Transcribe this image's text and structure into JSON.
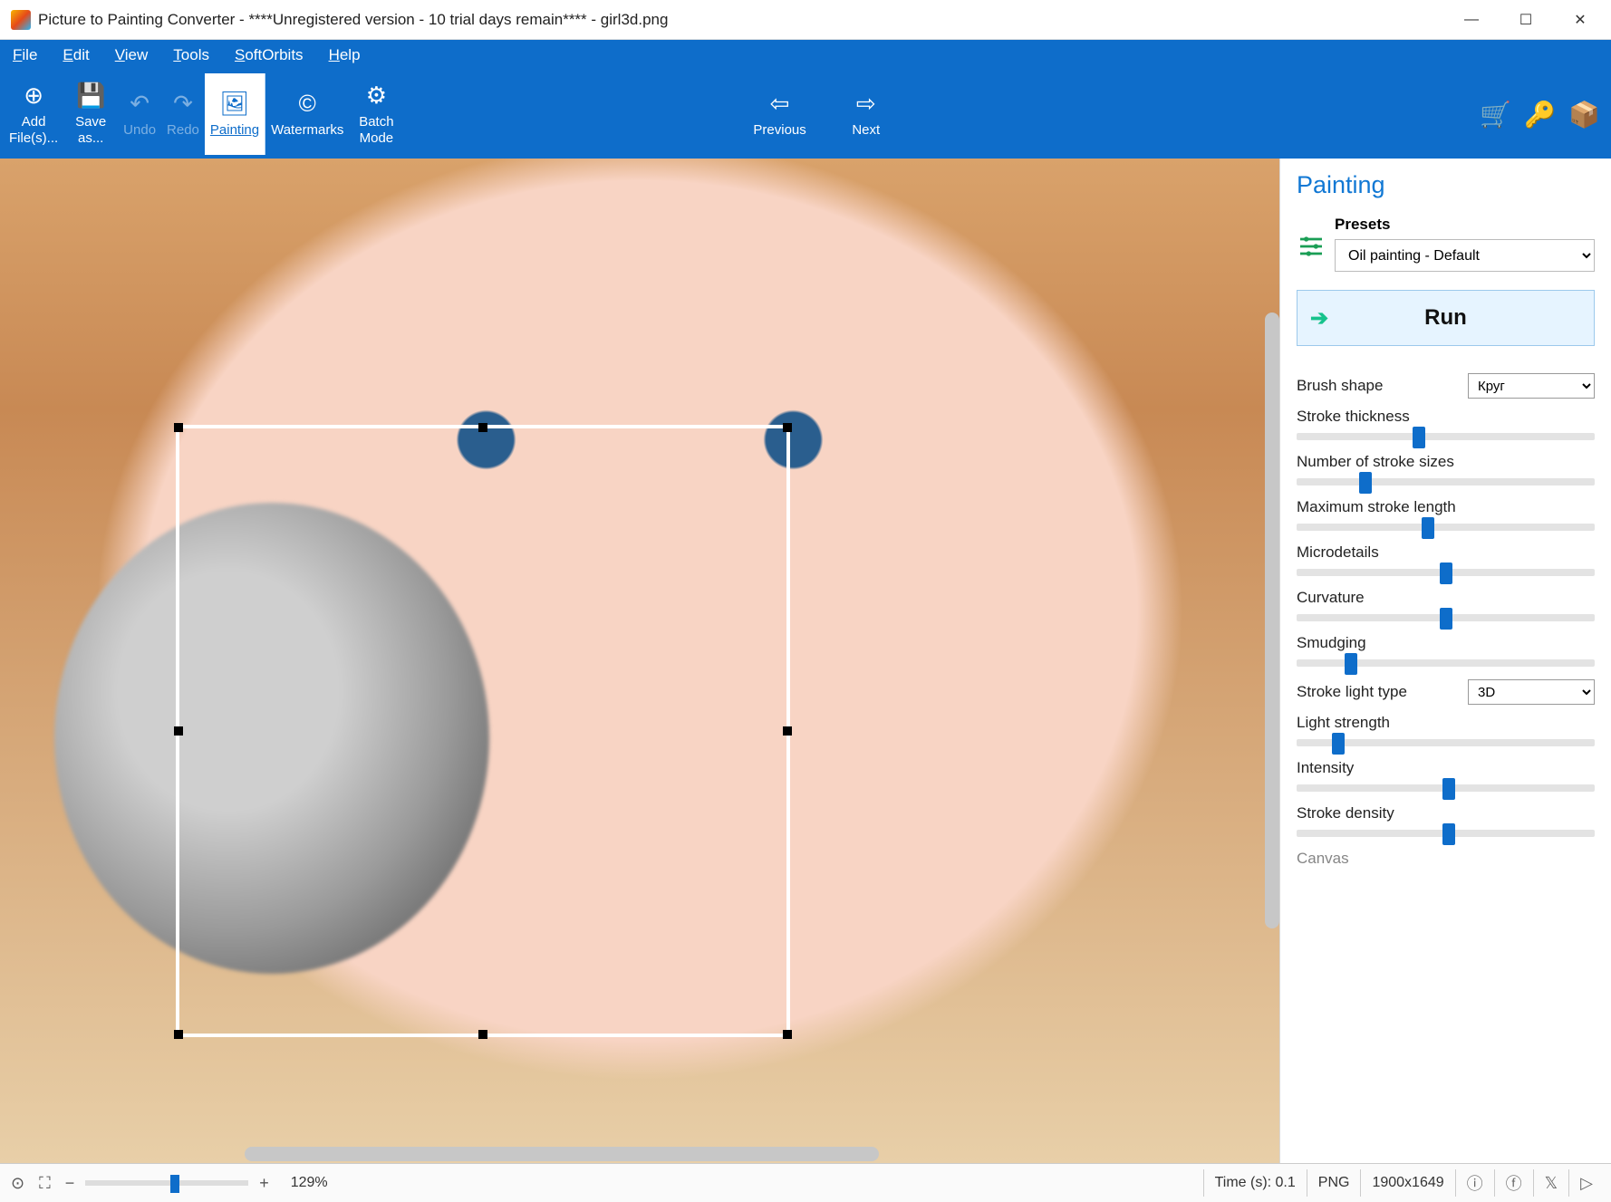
{
  "window": {
    "title": "Picture to Painting Converter - ****Unregistered version - 10 trial days remain**** - girl3d.png"
  },
  "menu": {
    "file": "File",
    "edit": "Edit",
    "view": "View",
    "tools": "Tools",
    "softorbits": "SoftOrbits",
    "help": "Help"
  },
  "ribbon": {
    "add_files": "Add\nFile(s)...",
    "save_as": "Save\nas...",
    "undo": "Undo",
    "redo": "Redo",
    "painting": "Painting",
    "watermarks": "Watermarks",
    "batch_mode": "Batch\nMode",
    "previous": "Previous",
    "next": "Next"
  },
  "panel": {
    "title": "Painting",
    "presets_label": "Presets",
    "preset_value": "Oil painting - Default",
    "run": "Run",
    "brush_shape_label": "Brush shape",
    "brush_shape_value": "Круг",
    "stroke_light_label": "Stroke light type",
    "stroke_light_value": "3D",
    "sliders": [
      {
        "label": "Stroke thickness",
        "pos": 39
      },
      {
        "label": "Number of stroke sizes",
        "pos": 21
      },
      {
        "label": "Maximum stroke length",
        "pos": 42
      },
      {
        "label": "Microdetails",
        "pos": 48
      },
      {
        "label": "Curvature",
        "pos": 48
      },
      {
        "label": "Smudging",
        "pos": 16
      }
    ],
    "sliders2": [
      {
        "label": "Light strength",
        "pos": 12
      },
      {
        "label": "Intensity",
        "pos": 49
      },
      {
        "label": "Stroke density",
        "pos": 49
      }
    ],
    "canvas_label": "Canvas"
  },
  "status": {
    "zoom": "129%",
    "time": "Time (s): 0.1",
    "format": "PNG",
    "dims": "1900x1649"
  }
}
